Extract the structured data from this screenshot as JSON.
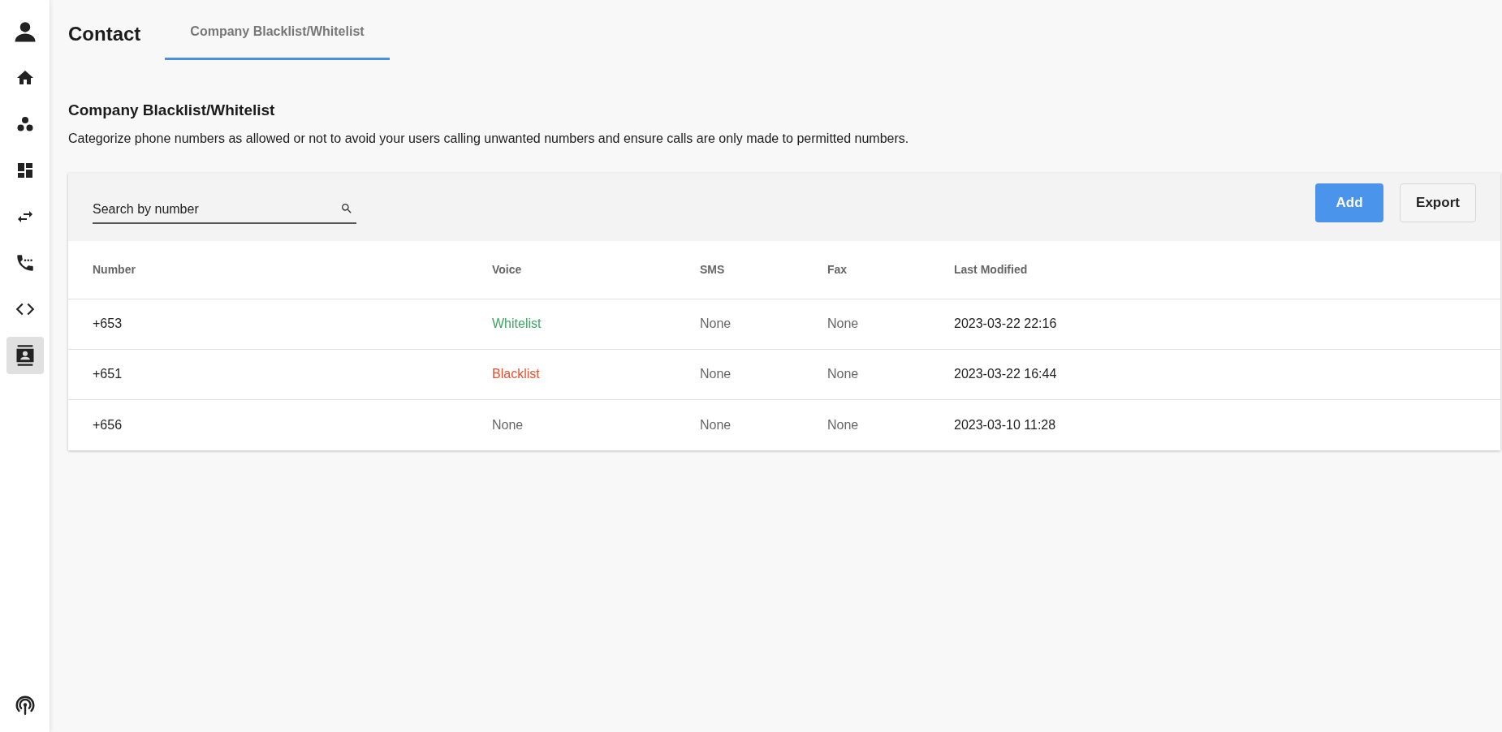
{
  "sidebar": {
    "items": [
      {
        "selected": false
      },
      {
        "selected": false
      },
      {
        "selected": false
      },
      {
        "selected": false
      },
      {
        "selected": false
      },
      {
        "selected": false
      },
      {
        "selected": false
      },
      {
        "selected": true
      }
    ]
  },
  "header": {
    "title": "Contact",
    "tabs": [
      {
        "label": "Company Blacklist/Whitelist",
        "selected": true
      }
    ]
  },
  "section": {
    "title": "Company Blacklist/Whitelist",
    "description": "Categorize phone numbers as allowed or not to avoid your users calling unwanted numbers and ensure calls are only made to permitted numbers."
  },
  "toolbar": {
    "search": {
      "placeholder": "Search by number"
    },
    "buttons": [
      {
        "label": "Add",
        "kind": "primary"
      },
      {
        "label": "Export",
        "kind": "secondary"
      }
    ]
  },
  "table": {
    "columns": [
      "Number",
      "Voice",
      "SMS",
      "Fax",
      "Last Modified"
    ],
    "rows": [
      {
        "number": "+653",
        "voice": {
          "text": "Whitelist",
          "kind": "whitelist"
        },
        "sms": {
          "text": "None",
          "kind": "none"
        },
        "fax": {
          "text": "None",
          "kind": "none"
        },
        "last_modified": "2023-03-22 22:16"
      },
      {
        "number": "+651",
        "voice": {
          "text": "Blacklist",
          "kind": "blacklist"
        },
        "sms": {
          "text": "None",
          "kind": "none"
        },
        "fax": {
          "text": "None",
          "kind": "none"
        },
        "last_modified": "2023-03-22 16:44"
      },
      {
        "number": "+656",
        "voice": {
          "text": "None",
          "kind": "none"
        },
        "sms": {
          "text": "None",
          "kind": "none"
        },
        "fax": {
          "text": "None",
          "kind": "none"
        },
        "last_modified": "2023-03-10 11:28"
      }
    ]
  }
}
